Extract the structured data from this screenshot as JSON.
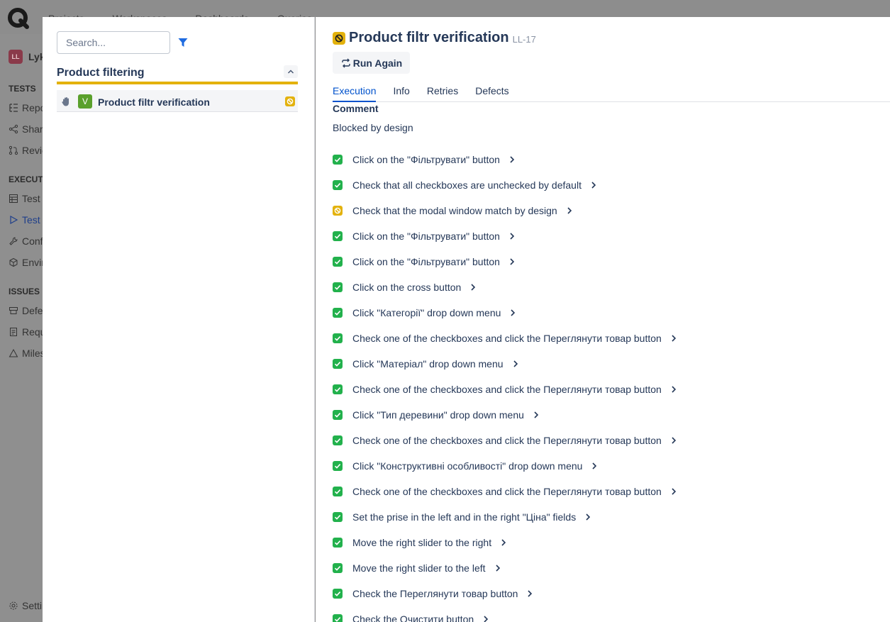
{
  "background": {
    "nav": [
      "Projects",
      "Workspaces",
      "Dashboards",
      "Queries"
    ],
    "project_initial": "LL",
    "project_name": "Lykos",
    "tests_section": "TESTS",
    "tests_items": [
      "Repository",
      "Shared Steps",
      "Reviews"
    ],
    "execution_section": "EXECUTION",
    "execution_items": [
      "Test Plans",
      "Test Runs",
      "Configurations",
      "Environments"
    ],
    "issues_section": "ISSUES",
    "issues_items": [
      "Defects",
      "Requirements",
      "Milestones"
    ],
    "settings": "Settings"
  },
  "left_panel": {
    "search_placeholder": "Search...",
    "suite_title": "Product filtering",
    "test": {
      "badge": "V",
      "name": "Product filtr verification",
      "status": "blocked"
    }
  },
  "detail": {
    "title": "Product filtr verification",
    "key": "LL-17",
    "run_again_label": "Run Again",
    "tabs": [
      "Execution",
      "Info",
      "Retries",
      "Defects"
    ],
    "active_tab": "Execution",
    "comment_label": "Comment",
    "comment_text": "Blocked by design",
    "steps": [
      {
        "text": "Click on the \"Фільтрувати\" button",
        "status": "passed"
      },
      {
        "text": "Check that all checkboxes are unchecked by default",
        "status": "passed"
      },
      {
        "text": "Check that the modal window match by design",
        "status": "blocked"
      },
      {
        "text": "Click on the \"Фільтрувати\" button",
        "status": "passed"
      },
      {
        "text": "Click on the \"Фільтрувати\" button",
        "status": "passed"
      },
      {
        "text": "Click on the cross button",
        "status": "passed"
      },
      {
        "text": "Click \"Категорії\" drop down menu",
        "status": "passed"
      },
      {
        "text": "Check one of the checkboxes and click the Переглянути товар button",
        "status": "passed"
      },
      {
        "text": "Click \"Матеріал\" drop down menu",
        "status": "passed"
      },
      {
        "text": "Check one of the checkboxes and click the Переглянути товар button",
        "status": "passed"
      },
      {
        "text": "Click \"Тип деревини\" drop down menu",
        "status": "passed"
      },
      {
        "text": "Check one of the checkboxes and click the Переглянути товар button",
        "status": "passed"
      },
      {
        "text": "Click \"Конструктивні особливості\" drop down menu",
        "status": "passed"
      },
      {
        "text": "Check one of the checkboxes and click the Переглянути товар button",
        "status": "passed"
      },
      {
        "text": "Set the prise in the left and in the right \"Ціна\" fields",
        "status": "passed"
      },
      {
        "text": "Move the right slider to the right",
        "status": "passed"
      },
      {
        "text": "Move the right slider to the left",
        "status": "passed"
      },
      {
        "text": "Check the Переглянути товар button",
        "status": "passed"
      },
      {
        "text": "Check the Очистити button",
        "status": "passed"
      }
    ]
  },
  "colors": {
    "passed": "#22b14c",
    "blocked": "#e3b20d",
    "accent": "#0052cc",
    "badge_v": "#5aa02c"
  }
}
